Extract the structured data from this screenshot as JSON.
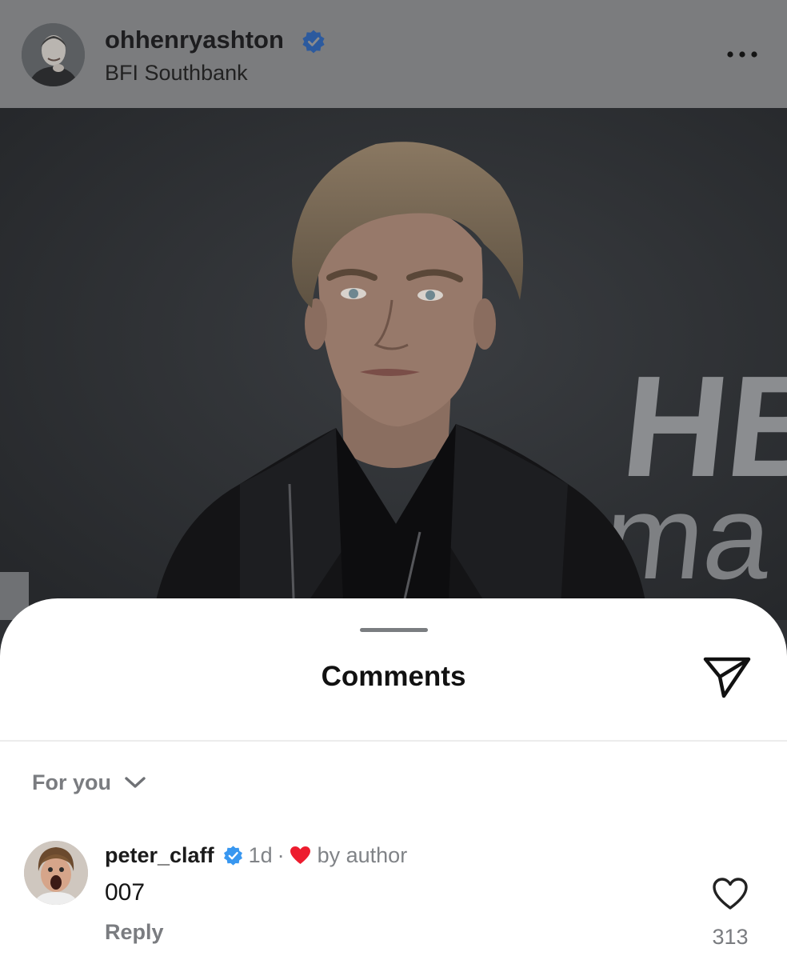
{
  "post": {
    "username": "ohhenryashton",
    "location": "BFI Southbank",
    "verified": true,
    "photo_backdrop_text_1": "HB",
    "photo_backdrop_text_2": "ma"
  },
  "comments_sheet": {
    "title": "Comments",
    "sort_option": "For you",
    "comments": [
      {
        "username": "peter_claff",
        "verified": true,
        "time": "1d",
        "separator": "·",
        "liked_by_author_text": "by author",
        "text": "007",
        "reply_label": "Reply",
        "like_count": "313"
      }
    ]
  },
  "colors": {
    "verified_blue": "#3897f0",
    "heart_red": "#ed1c2e",
    "muted_text": "#7a7c80"
  },
  "icons": [
    "verified-badge-icon",
    "more-icon",
    "share-icon",
    "chevron-down-icon",
    "heart-icon",
    "heart-outline-icon"
  ]
}
